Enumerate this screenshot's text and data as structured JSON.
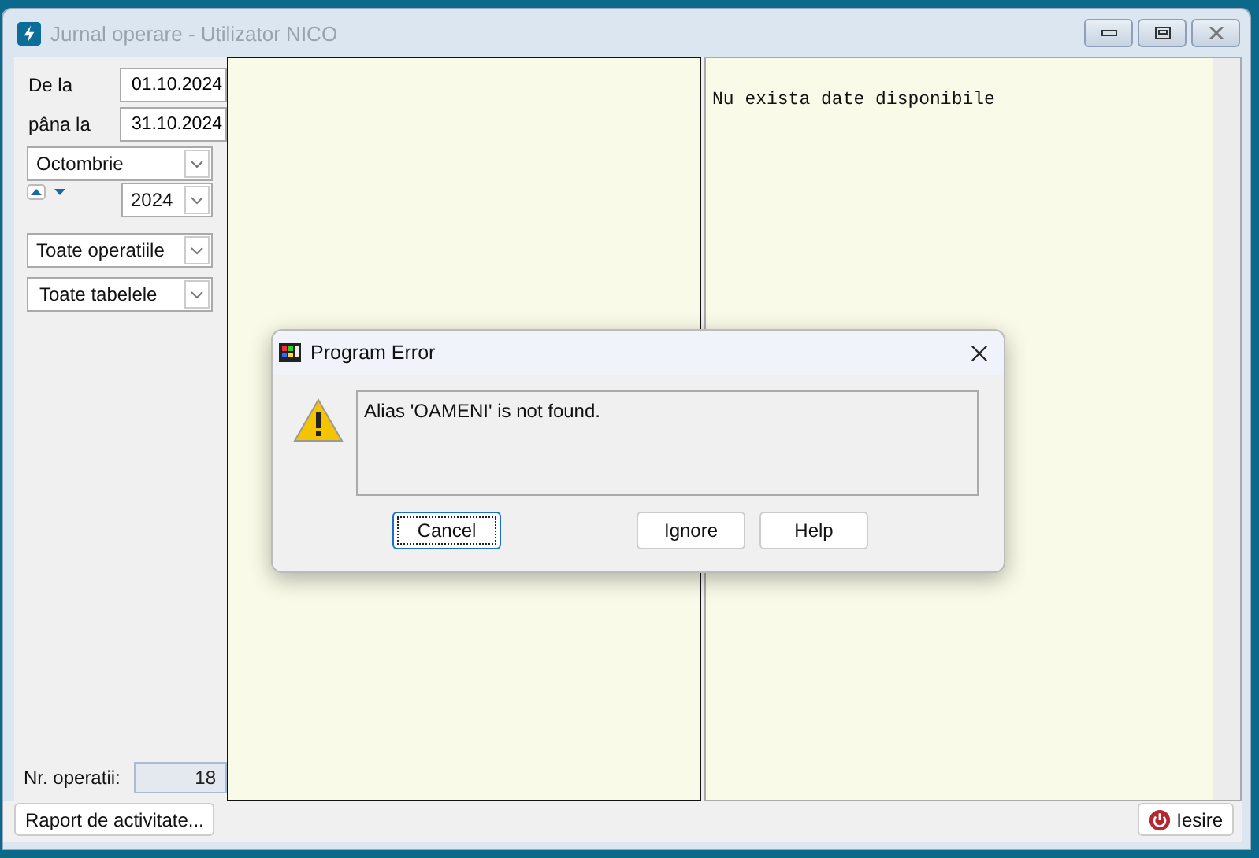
{
  "window": {
    "title": "Jurnal operare - Utilizator NICO"
  },
  "filters": {
    "from_label": "De la",
    "from_value": "01.10.2024",
    "to_label": "pâna la",
    "to_value": "31.10.2024",
    "month": "Octombrie",
    "year": "2024",
    "operations": "Toate operatiile",
    "tables": "Toate tabelele"
  },
  "count": {
    "label": "Nr. operatii:",
    "value": "18"
  },
  "detail": {
    "message": "Nu exista date disponibile"
  },
  "buttons": [
    {
      "label": "Raport de activitate...",
      "kind": "report"
    },
    {
      "label": "Iesire",
      "kind": "exit"
    }
  ],
  "dialog": {
    "title": "Program Error",
    "message": "Alias 'OAMENI' is not found.",
    "buttons": [
      {
        "label": "Cancel",
        "focused": true
      },
      {
        "label": "Ignore",
        "focused": false
      },
      {
        "label": "Help",
        "focused": false
      }
    ]
  }
}
